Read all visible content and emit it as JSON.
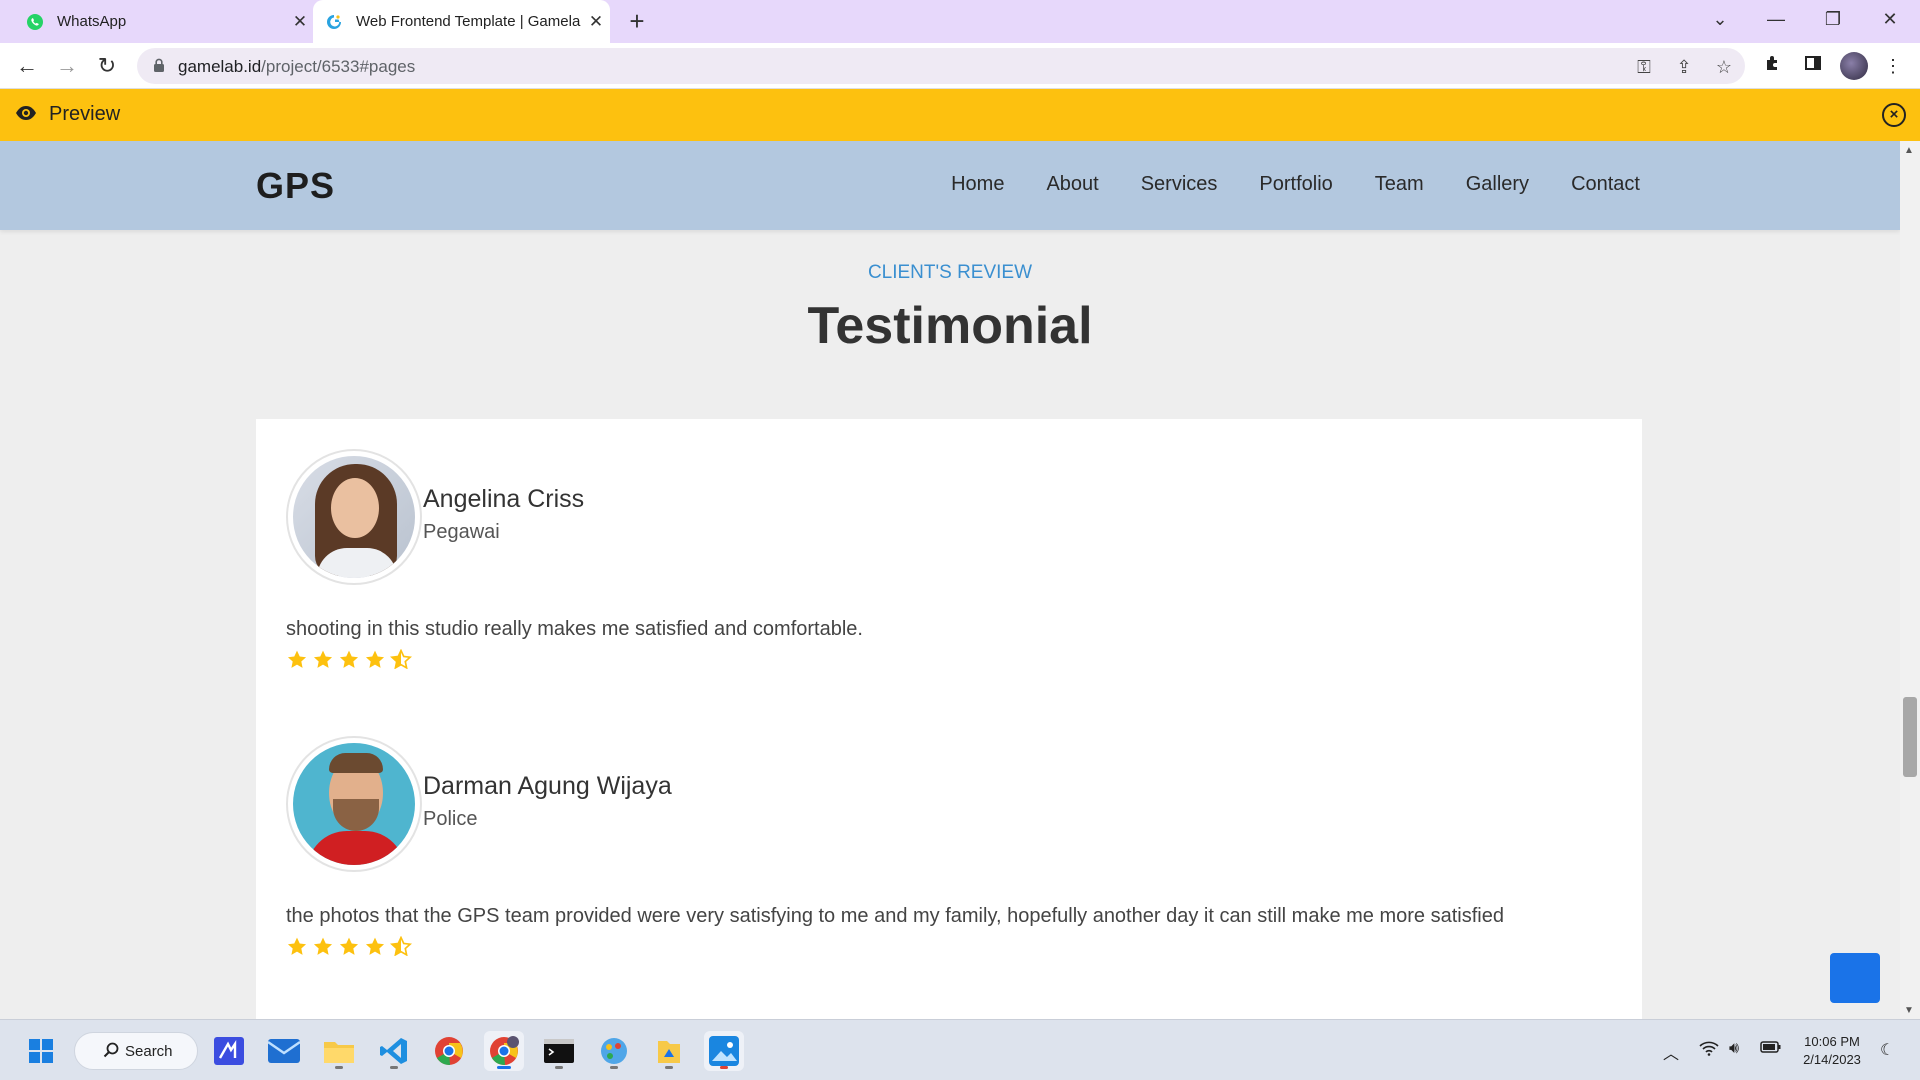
{
  "browser": {
    "tabs": [
      {
        "title": "WhatsApp"
      },
      {
        "title": "Web Frontend Template | Gamela"
      }
    ],
    "url": {
      "domain": "gamelab.id",
      "path": "/project/6533#pages"
    }
  },
  "preview_bar": {
    "label": "Preview"
  },
  "site": {
    "brand": "GPS",
    "nav": [
      "Home",
      "About",
      "Services",
      "Portfolio",
      "Team",
      "Gallery",
      "Contact"
    ],
    "section": {
      "eyebrow": "CLIENT'S REVIEW",
      "title": "Testimonial"
    },
    "reviews": [
      {
        "name": "Angelina Criss",
        "role": "Pegawai",
        "text": "shooting in this studio really makes me satisfied and comfortable.",
        "rating": 4.5
      },
      {
        "name": "Darman Agung Wijaya",
        "role": "Police",
        "text": "the photos that the GPS team provided were very satisfying to me and my family, hopefully another day it can still make me more satisfied",
        "rating": 4.5
      }
    ]
  },
  "taskbar": {
    "search_label": "Search",
    "time": "10:06 PM",
    "date": "2/14/2023"
  },
  "colors": {
    "tab_strip": "#e7d8fb",
    "preview_bar": "#fdc10f",
    "site_nav": "#b3c8df",
    "eyebrow": "#3a8fd0",
    "star": "#fdc10f",
    "float_button": "#1a73e8"
  }
}
